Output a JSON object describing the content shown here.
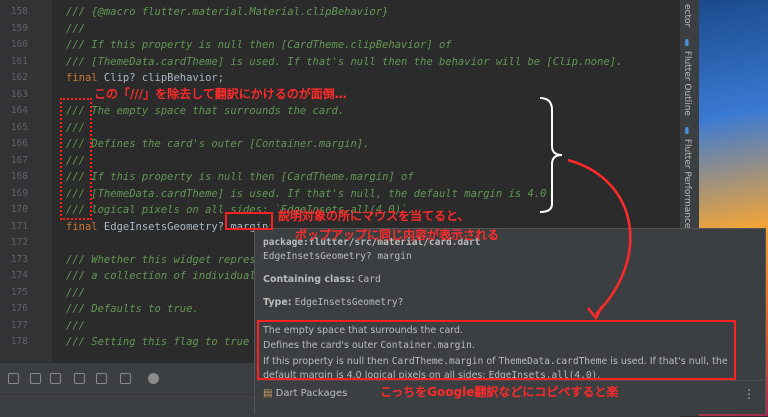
{
  "editor": {
    "lines": [
      {
        "num": "158",
        "text": "/// {@macro flutter.material.Material.clipBehavior}",
        "cls": "cm"
      },
      {
        "num": "159",
        "text": "///",
        "cls": "cm"
      },
      {
        "num": "160",
        "text": "/// If this property is null then [CardTheme.clipBehavior] of",
        "cls": "cm"
      },
      {
        "num": "161",
        "text": "/// [ThemeData.cardTheme] is used. If that's null then the behavior will be [Clip.none].",
        "cls": "cm"
      },
      {
        "num": "162",
        "text": "final Clip? clipBehavior;",
        "cls": "code"
      },
      {
        "num": "163",
        "text": "",
        "cls": "code"
      },
      {
        "num": "164",
        "text": "/// The empty space that surrounds the card.",
        "cls": "cm"
      },
      {
        "num": "165",
        "text": "///",
        "cls": "cm"
      },
      {
        "num": "166",
        "text": "/// Defines the card's outer [Container.margin].",
        "cls": "cm"
      },
      {
        "num": "167",
        "text": "///",
        "cls": "cm"
      },
      {
        "num": "168",
        "text": "/// If this property is null then [CardTheme.margin] of",
        "cls": "cm"
      },
      {
        "num": "169",
        "text": "/// [ThemeData.cardTheme] is used. If that's null, the default margin is 4.0",
        "cls": "cm"
      },
      {
        "num": "170",
        "text": "/// logical pixels on all sides: `EdgeInsets.all(4.0)`.",
        "cls": "cm"
      },
      {
        "num": "171",
        "text": "final EdgeInsetsGeometry? margin;",
        "cls": "code"
      },
      {
        "num": "172",
        "text": "",
        "cls": "code"
      },
      {
        "num": "173",
        "text": "/// Whether this widget repres",
        "cls": "cm"
      },
      {
        "num": "174",
        "text": "/// a collection of individual",
        "cls": "cm"
      },
      {
        "num": "175",
        "text": "///",
        "cls": "cm"
      },
      {
        "num": "176",
        "text": "/// Defaults to true.",
        "cls": "cm"
      },
      {
        "num": "177",
        "text": "///",
        "cls": "cm"
      },
      {
        "num": "178",
        "text": "/// Setting this flag to true",
        "cls": "cm"
      }
    ]
  },
  "side_tabs": [
    "ector",
    "Flutter Outline",
    "Flutter Performance"
  ],
  "popup": {
    "package": "package:flutter/src/material/card.dart",
    "signature": "EdgeInsetsGeometry? margin",
    "containing_label": "Containing class:",
    "containing_value": "Card",
    "type_label": "Type:",
    "type_value": "EdgeInsetsGeometry?",
    "doc_line1": "The empty space that surrounds the card.",
    "doc_line2_prefix": "Defines the card's outer ",
    "doc_line2_code": "Container.margin",
    "doc_line2_suffix": ".",
    "doc_line3_a": "If this property is null then ",
    "doc_line3_code1": "CardTheme.margin",
    "doc_line3_b": " of ",
    "doc_line3_code2": "ThemeData.cardTheme",
    "doc_line3_c": " is used. If that's null, the",
    "doc_line4_a": "default margin is 4.0 logical pixels on all sides: ",
    "doc_line4_code": "EdgeInsets.all(4.0)",
    "doc_line4_b": ".",
    "footer_label": "Dart Packages",
    "more": "⋮"
  },
  "annotations": {
    "top": "この「///」を除去して翻訳にかけるのが面倒…",
    "middle_line1": "説明対象の所にマウスを当てると、",
    "middle_line2": "ポップアップに同じ内容が表示される",
    "bottom": "こっちをGoogle翻訳などにコピペすると楽"
  },
  "colors": {
    "annotation": "#ff2a2a",
    "comment": "#629755",
    "keyword": "#cc7832"
  }
}
